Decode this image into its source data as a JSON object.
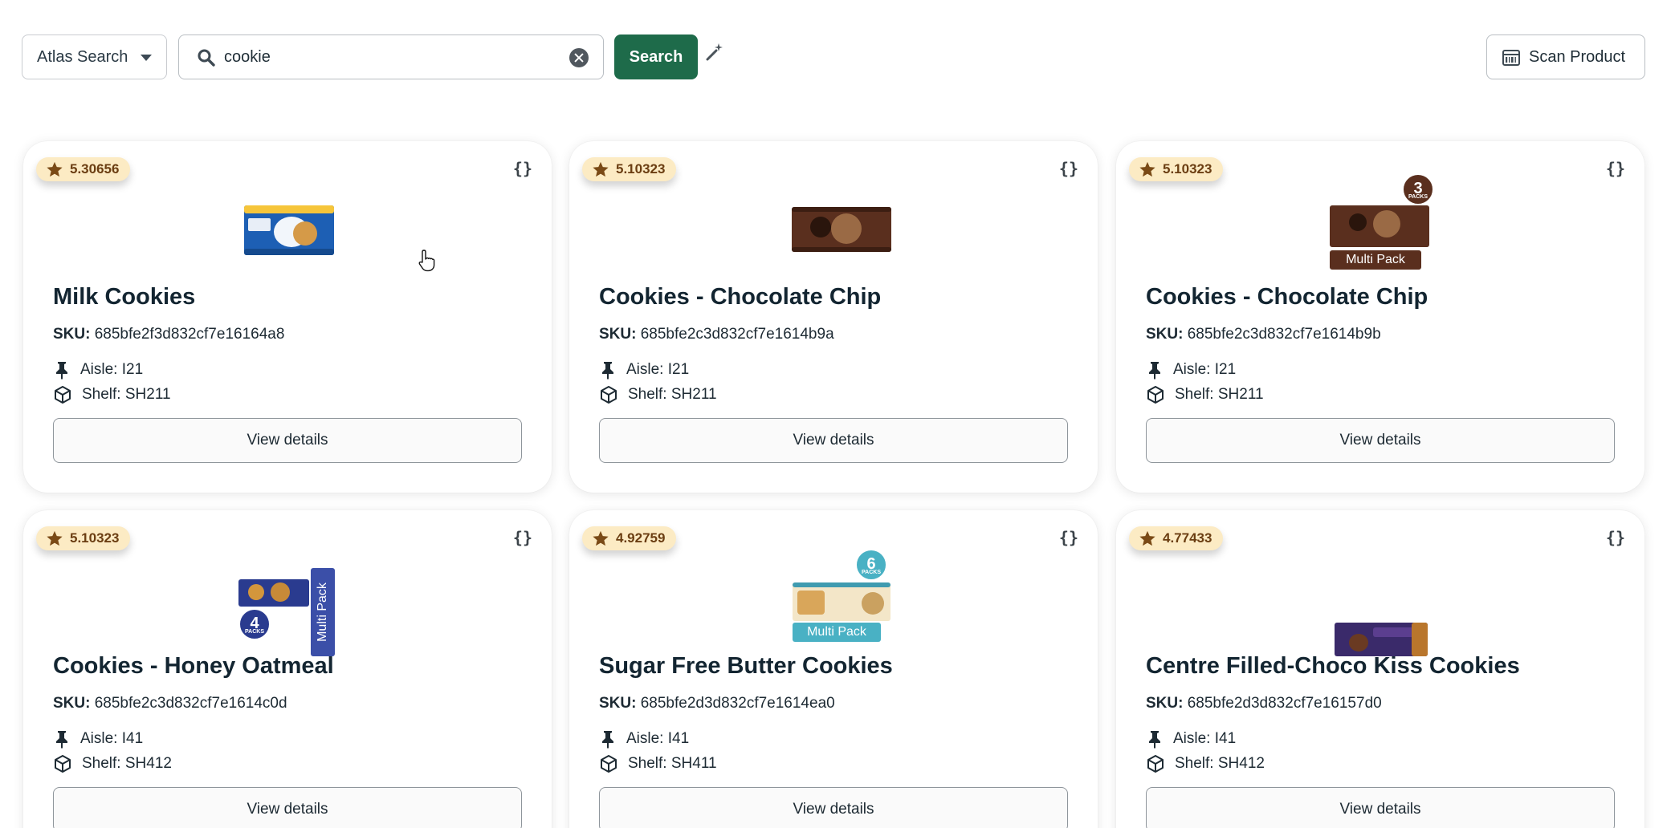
{
  "toolbar": {
    "mode_label": "Atlas Search",
    "search_value": "cookie",
    "search_button": "Search",
    "scan_button": "Scan Product"
  },
  "colors": {
    "primary": "#1e6b4a",
    "score_badge_bg": "#fcebc4",
    "score_text": "#6b3e12"
  },
  "cards": [
    {
      "score": "5.30656",
      "title": "Milk Cookies",
      "sku_label": "SKU:",
      "sku": "685bfe2f3d832cf7e16164a8",
      "aisle": "Aisle: I21",
      "shelf": "Shelf: SH211",
      "button": "View details"
    },
    {
      "score": "5.10323",
      "title": "Cookies - Chocolate Chip",
      "sku_label": "SKU:",
      "sku": "685bfe2c3d832cf7e1614b9a",
      "aisle": "Aisle: I21",
      "shelf": "Shelf: SH211",
      "button": "View details"
    },
    {
      "score": "5.10323",
      "title": "Cookies - Chocolate Chip",
      "sku_label": "SKU:",
      "sku": "685bfe2c3d832cf7e1614b9b",
      "aisle": "Aisle: I21",
      "shelf": "Shelf: SH211",
      "button": "View details",
      "pack_count": "3",
      "pack_word": "PACKS",
      "ribbon": "Multi Pack"
    },
    {
      "score": "5.10323",
      "title": "Cookies - Honey Oatmeal",
      "sku_label": "SKU:",
      "sku": "685bfe2c3d832cf7e1614c0d",
      "aisle": "Aisle: I41",
      "shelf": "Shelf: SH412",
      "button": "View details",
      "pack_count": "4",
      "pack_word": "PACKS",
      "ribbon": "Multi Pack"
    },
    {
      "score": "4.92759",
      "title": "Sugar Free Butter Cookies",
      "sku_label": "SKU:",
      "sku": "685bfe2d3d832cf7e1614ea0",
      "aisle": "Aisle: I41",
      "shelf": "Shelf: SH411",
      "button": "View details",
      "pack_count": "6",
      "pack_word": "PACKS",
      "ribbon": "Multi Pack"
    },
    {
      "score": "4.77433",
      "title": "Centre Filled-Choco Kiss Cookies",
      "sku_label": "SKU:",
      "sku": "685bfe2d3d832cf7e16157d0",
      "aisle": "Aisle: I41",
      "shelf": "Shelf: SH412",
      "button": "View details"
    }
  ]
}
